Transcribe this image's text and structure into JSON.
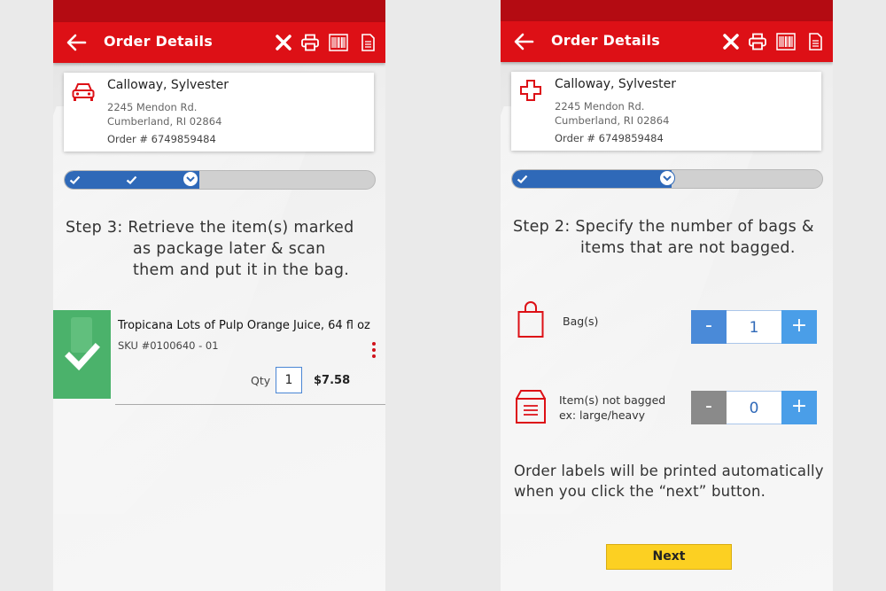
{
  "colors": {
    "brand_red": "#dd1016",
    "status_red": "#b40b12",
    "progress_blue": "#2f69b8",
    "minus_blue": "#4a8ad8",
    "plus_blue": "#4a9ee8",
    "disabled_gray": "#8a8a8a",
    "next_yellow": "#fcd022",
    "item_green": "#4bb26b"
  },
  "left_screen": {
    "header": {
      "title": "Order Details",
      "icons": [
        "back-arrow-icon",
        "close-icon",
        "printer-icon",
        "barcode-icon",
        "document-icon"
      ]
    },
    "customer": {
      "icon": "car-icon",
      "name": "Calloway, Sylvester",
      "address_line1": "2245 Mendon Rd.",
      "address_line2": "Cumberland, RI 02864",
      "order_number": "Order # 6749859484"
    },
    "progress": {
      "completed_steps": 2,
      "current_step": 3,
      "fill_fraction": 0.43
    },
    "step_text": {
      "line1": "Step 3: Retrieve the item(s) marked",
      "line2": "as package later & scan",
      "line3": "them and put it in the bag."
    },
    "item": {
      "title": "Tropicana Lots of Pulp Orange Juice, 64 fl oz",
      "sku": "SKU #0100640 - 01",
      "qty_label": "Qty",
      "qty_value": "1",
      "price": "$7.58",
      "status_icon": "checkmark-icon"
    }
  },
  "right_screen": {
    "header": {
      "title": "Order Details",
      "icons": [
        "back-arrow-icon",
        "close-icon",
        "printer-icon",
        "barcode-icon",
        "document-icon"
      ]
    },
    "customer": {
      "icon": "medical-cross-icon",
      "name": "Calloway, Sylvester",
      "address_line1": "2245 Mendon Rd.",
      "address_line2": "Cumberland, RI 02864",
      "order_number": "Order # 6749859484"
    },
    "progress": {
      "completed_steps": 1,
      "current_step": 2,
      "fill_fraction": 0.51
    },
    "step_text": {
      "line1": "Step 2: Specify the number of bags &",
      "line2": "items that are not bagged."
    },
    "bags": {
      "label": "Bag(s)",
      "minus": "-",
      "value": "1",
      "plus": "+"
    },
    "not_bagged": {
      "label_line1": "Item(s) not bagged",
      "label_line2": "ex: large/heavy",
      "minus": "-",
      "value": "0",
      "plus": "+"
    },
    "note": {
      "line1": "Order labels will be printed automatically",
      "line2": "when you click the “next” button."
    },
    "next_button": "Next"
  }
}
